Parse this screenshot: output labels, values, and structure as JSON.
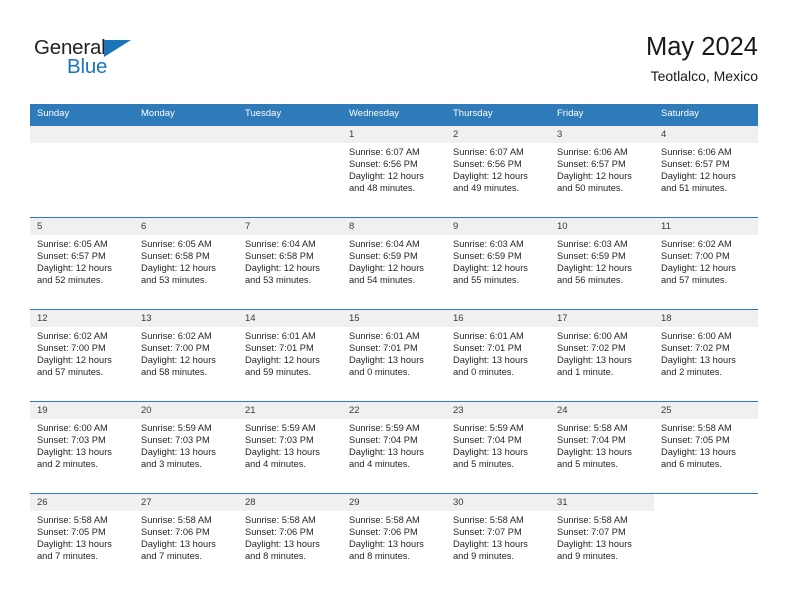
{
  "brand": {
    "name_top": "General",
    "name_bottom": "Blue",
    "triangle_icon": "blue-triangle-logo-mark",
    "accent_color": "#1b75bb"
  },
  "header": {
    "title": "May 2024",
    "subtitle": "Teotlalco, Mexico"
  },
  "theme": {
    "header_row_bg": "#2f7ab9",
    "row_divider": "#2f7ab9",
    "day_number_band_bg": "#f0f0f0",
    "text_color": "#262626"
  },
  "weekdays": [
    "Sunday",
    "Monday",
    "Tuesday",
    "Wednesday",
    "Thursday",
    "Friday",
    "Saturday"
  ],
  "calendar": {
    "month": "May",
    "year": "2024",
    "location": "Teotlalco, Mexico",
    "weeks": [
      [
        {
          "day": "",
          "blank": true,
          "sunrise": "",
          "sunset": "",
          "daylight_line1": "",
          "daylight_line2": ""
        },
        {
          "day": "",
          "blank": true,
          "sunrise": "",
          "sunset": "",
          "daylight_line1": "",
          "daylight_line2": ""
        },
        {
          "day": "",
          "blank": true,
          "sunrise": "",
          "sunset": "",
          "daylight_line1": "",
          "daylight_line2": ""
        },
        {
          "day": "1",
          "sunrise": "Sunrise: 6:07 AM",
          "sunset": "Sunset: 6:56 PM",
          "daylight_line1": "Daylight: 12 hours",
          "daylight_line2": "and 48 minutes."
        },
        {
          "day": "2",
          "sunrise": "Sunrise: 6:07 AM",
          "sunset": "Sunset: 6:56 PM",
          "daylight_line1": "Daylight: 12 hours",
          "daylight_line2": "and 49 minutes."
        },
        {
          "day": "3",
          "sunrise": "Sunrise: 6:06 AM",
          "sunset": "Sunset: 6:57 PM",
          "daylight_line1": "Daylight: 12 hours",
          "daylight_line2": "and 50 minutes."
        },
        {
          "day": "4",
          "sunrise": "Sunrise: 6:06 AM",
          "sunset": "Sunset: 6:57 PM",
          "daylight_line1": "Daylight: 12 hours",
          "daylight_line2": "and 51 minutes."
        }
      ],
      [
        {
          "day": "5",
          "sunrise": "Sunrise: 6:05 AM",
          "sunset": "Sunset: 6:57 PM",
          "daylight_line1": "Daylight: 12 hours",
          "daylight_line2": "and 52 minutes."
        },
        {
          "day": "6",
          "sunrise": "Sunrise: 6:05 AM",
          "sunset": "Sunset: 6:58 PM",
          "daylight_line1": "Daylight: 12 hours",
          "daylight_line2": "and 53 minutes."
        },
        {
          "day": "7",
          "sunrise": "Sunrise: 6:04 AM",
          "sunset": "Sunset: 6:58 PM",
          "daylight_line1": "Daylight: 12 hours",
          "daylight_line2": "and 53 minutes."
        },
        {
          "day": "8",
          "sunrise": "Sunrise: 6:04 AM",
          "sunset": "Sunset: 6:59 PM",
          "daylight_line1": "Daylight: 12 hours",
          "daylight_line2": "and 54 minutes."
        },
        {
          "day": "9",
          "sunrise": "Sunrise: 6:03 AM",
          "sunset": "Sunset: 6:59 PM",
          "daylight_line1": "Daylight: 12 hours",
          "daylight_line2": "and 55 minutes."
        },
        {
          "day": "10",
          "sunrise": "Sunrise: 6:03 AM",
          "sunset": "Sunset: 6:59 PM",
          "daylight_line1": "Daylight: 12 hours",
          "daylight_line2": "and 56 minutes."
        },
        {
          "day": "11",
          "sunrise": "Sunrise: 6:02 AM",
          "sunset": "Sunset: 7:00 PM",
          "daylight_line1": "Daylight: 12 hours",
          "daylight_line2": "and 57 minutes."
        }
      ],
      [
        {
          "day": "12",
          "sunrise": "Sunrise: 6:02 AM",
          "sunset": "Sunset: 7:00 PM",
          "daylight_line1": "Daylight: 12 hours",
          "daylight_line2": "and 57 minutes."
        },
        {
          "day": "13",
          "sunrise": "Sunrise: 6:02 AM",
          "sunset": "Sunset: 7:00 PM",
          "daylight_line1": "Daylight: 12 hours",
          "daylight_line2": "and 58 minutes."
        },
        {
          "day": "14",
          "sunrise": "Sunrise: 6:01 AM",
          "sunset": "Sunset: 7:01 PM",
          "daylight_line1": "Daylight: 12 hours",
          "daylight_line2": "and 59 minutes."
        },
        {
          "day": "15",
          "sunrise": "Sunrise: 6:01 AM",
          "sunset": "Sunset: 7:01 PM",
          "daylight_line1": "Daylight: 13 hours",
          "daylight_line2": "and 0 minutes."
        },
        {
          "day": "16",
          "sunrise": "Sunrise: 6:01 AM",
          "sunset": "Sunset: 7:01 PM",
          "daylight_line1": "Daylight: 13 hours",
          "daylight_line2": "and 0 minutes."
        },
        {
          "day": "17",
          "sunrise": "Sunrise: 6:00 AM",
          "sunset": "Sunset: 7:02 PM",
          "daylight_line1": "Daylight: 13 hours",
          "daylight_line2": "and 1 minute."
        },
        {
          "day": "18",
          "sunrise": "Sunrise: 6:00 AM",
          "sunset": "Sunset: 7:02 PM",
          "daylight_line1": "Daylight: 13 hours",
          "daylight_line2": "and 2 minutes."
        }
      ],
      [
        {
          "day": "19",
          "sunrise": "Sunrise: 6:00 AM",
          "sunset": "Sunset: 7:03 PM",
          "daylight_line1": "Daylight: 13 hours",
          "daylight_line2": "and 2 minutes."
        },
        {
          "day": "20",
          "sunrise": "Sunrise: 5:59 AM",
          "sunset": "Sunset: 7:03 PM",
          "daylight_line1": "Daylight: 13 hours",
          "daylight_line2": "and 3 minutes."
        },
        {
          "day": "21",
          "sunrise": "Sunrise: 5:59 AM",
          "sunset": "Sunset: 7:03 PM",
          "daylight_line1": "Daylight: 13 hours",
          "daylight_line2": "and 4 minutes."
        },
        {
          "day": "22",
          "sunrise": "Sunrise: 5:59 AM",
          "sunset": "Sunset: 7:04 PM",
          "daylight_line1": "Daylight: 13 hours",
          "daylight_line2": "and 4 minutes."
        },
        {
          "day": "23",
          "sunrise": "Sunrise: 5:59 AM",
          "sunset": "Sunset: 7:04 PM",
          "daylight_line1": "Daylight: 13 hours",
          "daylight_line2": "and 5 minutes."
        },
        {
          "day": "24",
          "sunrise": "Sunrise: 5:58 AM",
          "sunset": "Sunset: 7:04 PM",
          "daylight_line1": "Daylight: 13 hours",
          "daylight_line2": "and 5 minutes."
        },
        {
          "day": "25",
          "sunrise": "Sunrise: 5:58 AM",
          "sunset": "Sunset: 7:05 PM",
          "daylight_line1": "Daylight: 13 hours",
          "daylight_line2": "and 6 minutes."
        }
      ],
      [
        {
          "day": "26",
          "sunrise": "Sunrise: 5:58 AM",
          "sunset": "Sunset: 7:05 PM",
          "daylight_line1": "Daylight: 13 hours",
          "daylight_line2": "and 7 minutes."
        },
        {
          "day": "27",
          "sunrise": "Sunrise: 5:58 AM",
          "sunset": "Sunset: 7:06 PM",
          "daylight_line1": "Daylight: 13 hours",
          "daylight_line2": "and 7 minutes."
        },
        {
          "day": "28",
          "sunrise": "Sunrise: 5:58 AM",
          "sunset": "Sunset: 7:06 PM",
          "daylight_line1": "Daylight: 13 hours",
          "daylight_line2": "and 8 minutes."
        },
        {
          "day": "29",
          "sunrise": "Sunrise: 5:58 AM",
          "sunset": "Sunset: 7:06 PM",
          "daylight_line1": "Daylight: 13 hours",
          "daylight_line2": "and 8 minutes."
        },
        {
          "day": "30",
          "sunrise": "Sunrise: 5:58 AM",
          "sunset": "Sunset: 7:07 PM",
          "daylight_line1": "Daylight: 13 hours",
          "daylight_line2": "and 9 minutes."
        },
        {
          "day": "31",
          "sunrise": "Sunrise: 5:58 AM",
          "sunset": "Sunset: 7:07 PM",
          "daylight_line1": "Daylight: 13 hours",
          "daylight_line2": "and 9 minutes."
        },
        {
          "day": "",
          "trailing": true,
          "sunrise": "",
          "sunset": "",
          "daylight_line1": "",
          "daylight_line2": ""
        }
      ]
    ]
  }
}
